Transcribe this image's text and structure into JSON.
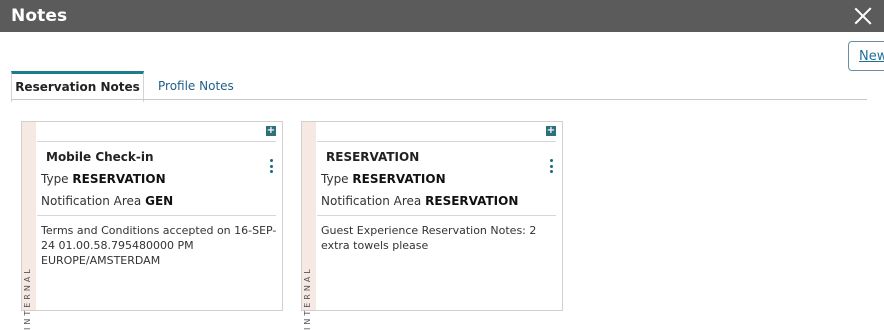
{
  "window": {
    "title": "Notes"
  },
  "toolbar": {
    "new_label": "New"
  },
  "tabs": [
    {
      "label": "Reservation Notes",
      "active": true
    },
    {
      "label": "Profile Notes",
      "active": false
    }
  ],
  "notes": [
    {
      "title": "Mobile Check-in",
      "type_label": "Type",
      "type_value": "RESERVATION",
      "area_label": "Notification Area",
      "area_value": "GEN",
      "text": "Terms and Conditions accepted on 16-SEP-24 01.00.58.795480000 PM EUROPE/AMSTERDAM",
      "visibility": "INTERNAL"
    },
    {
      "title": "RESERVATION",
      "type_label": "Type",
      "type_value": "RESERVATION",
      "area_label": "Notification Area",
      "area_value": "RESERVATION",
      "text": "Guest Experience Reservation Notes: 2 extra towels please",
      "visibility": "INTERNAL"
    }
  ],
  "colors": {
    "title_bar": "#5b5b5b",
    "accent": "#1a7c8c",
    "strip": "#f6e9e3"
  }
}
